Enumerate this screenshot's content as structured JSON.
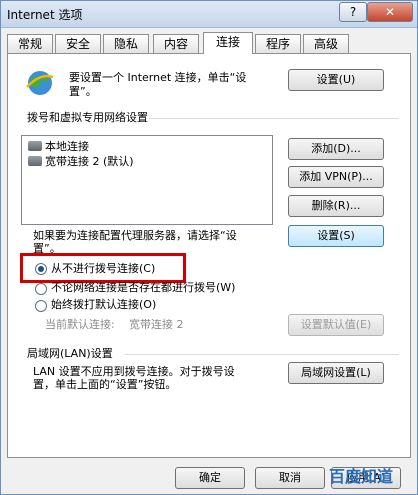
{
  "window": {
    "title": "Internet 选项",
    "help": "?",
    "close": "✕"
  },
  "tabs": [
    "常规",
    "安全",
    "隐私",
    "内容",
    "连接",
    "程序",
    "高级"
  ],
  "setup": {
    "text_line1": "要设置一个 Internet 连接，单击“设",
    "text_line2": "置”。",
    "button": "设置(U)"
  },
  "dialup": {
    "header": "拨号和虚拟专用网络设置",
    "items": [
      "本地连接",
      "宽带连接 2 (默认)"
    ],
    "add": "添加(D)...",
    "add_vpn": "添加 VPN(P)...",
    "delete": "删除(R)...",
    "proxy_line1": "如果要为连接配置代理服务器，请选择“设",
    "proxy_line2": "置”。",
    "settings": "设置(S)",
    "options": [
      "从不进行拨号连接(C)",
      "不论网络连接是否存在都进行拨号(W)",
      "始终拨打默认连接(O)"
    ],
    "current_default_label": "当前默认连接:",
    "current_default_value": "宽带连接 2",
    "set_default": "设置默认值(E)"
  },
  "lan": {
    "header": "局域网(LAN)设置",
    "text_line1": "LAN 设置不应用到拨号连接。对于拨号设",
    "text_line2": "置，单击上面的“设置”按钮。",
    "button": "局域网设置(L)"
  },
  "footer": {
    "ok": "确定",
    "cancel": "取消",
    "apply": "应用(A)"
  },
  "watermark": "百度知道"
}
